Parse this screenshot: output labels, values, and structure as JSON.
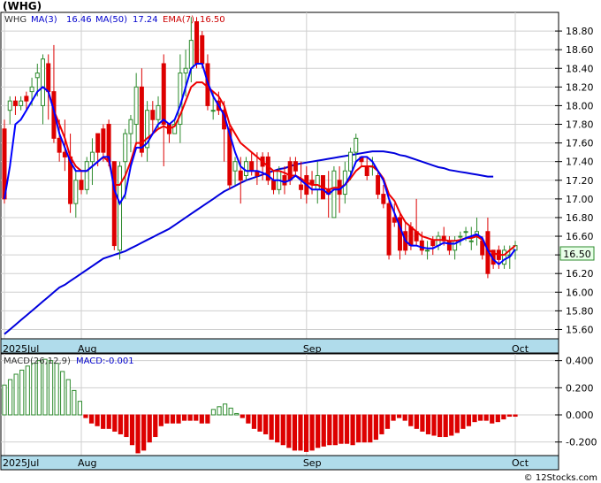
{
  "ticker_title": "(WHG)",
  "price_legend": {
    "symbol": "WHG",
    "ma3": "MA(3)",
    "ma3_value": "16.46",
    "ma50": "MA(50)",
    "ma50_value": "17.24",
    "ema7": "EMA(7)",
    "ema7_value": "16.50"
  },
  "macd_legend": {
    "label": "MACD(26,12,9)",
    "value": "MACD:-0.001"
  },
  "last_price_label": "16.50",
  "month_labels": [
    "2025Jul",
    "Aug",
    "Sep",
    "Oct"
  ],
  "copyright": "© 12Stocks.com",
  "colors": {
    "up": "#2e8b2e",
    "down": "#dd0000",
    "ma50": "#0000dd",
    "ma3": "#0000ff",
    "ema7": "#ee0000",
    "axis_band": "#b0dceb",
    "grid": "#cfcfcf",
    "price_tag": "#e8ffe8"
  },
  "chart_data": {
    "type": "candlestick",
    "price_axis": {
      "ylim": [
        15.5,
        19.0
      ],
      "ticks": [
        "15.60",
        "15.80",
        "16.00",
        "16.20",
        "16.40",
        "16.60",
        "16.80",
        "17.00",
        "17.20",
        "17.40",
        "17.60",
        "17.80",
        "18.00",
        "18.20",
        "18.40",
        "18.60",
        "18.80"
      ]
    },
    "macd_axis": {
      "ylim": [
        -0.3,
        0.45
      ],
      "ticks": [
        "-0.200",
        "0.000",
        "0.200",
        "0.400"
      ]
    },
    "candles": [
      [
        17.75,
        17.85,
        16.95,
        17.0
      ],
      [
        17.95,
        18.1,
        17.8,
        18.05
      ],
      [
        18.05,
        18.1,
        17.9,
        18.0
      ],
      [
        18.0,
        18.1,
        17.95,
        18.05
      ],
      [
        18.1,
        18.15,
        17.95,
        18.05
      ],
      [
        18.15,
        18.3,
        18.0,
        18.2
      ],
      [
        18.3,
        18.45,
        18.1,
        18.35
      ],
      [
        18.0,
        18.55,
        17.8,
        18.5
      ],
      [
        18.45,
        18.55,
        17.85,
        18.15
      ],
      [
        18.15,
        18.65,
        17.6,
        17.65
      ],
      [
        17.65,
        17.85,
        17.4,
        17.5
      ],
      [
        17.5,
        17.85,
        17.3,
        17.45
      ],
      [
        17.45,
        17.7,
        16.85,
        16.95
      ],
      [
        16.95,
        17.3,
        16.8,
        17.2
      ],
      [
        17.2,
        17.3,
        17.05,
        17.1
      ],
      [
        17.1,
        17.45,
        17.05,
        17.4
      ],
      [
        17.4,
        17.65,
        17.15,
        17.5
      ],
      [
        17.7,
        17.7,
        17.35,
        17.5
      ],
      [
        17.75,
        17.8,
        17.4,
        17.5
      ],
      [
        17.8,
        17.85,
        17.35,
        17.4
      ],
      [
        17.4,
        17.4,
        16.45,
        16.5
      ],
      [
        16.45,
        17.4,
        16.35,
        17.35
      ],
      [
        17.4,
        17.75,
        17.0,
        17.7
      ],
      [
        17.7,
        17.9,
        17.5,
        17.85
      ],
      [
        17.8,
        18.35,
        17.6,
        18.2
      ],
      [
        18.2,
        18.4,
        17.45,
        17.5
      ],
      [
        17.55,
        18.05,
        17.4,
        17.95
      ],
      [
        17.95,
        18.05,
        17.7,
        17.85
      ],
      [
        17.85,
        18.1,
        17.75,
        18.0
      ],
      [
        18.45,
        18.55,
        17.35,
        17.8
      ],
      [
        17.8,
        17.8,
        17.6,
        17.7
      ],
      [
        17.7,
        17.85,
        17.7,
        17.8
      ],
      [
        17.8,
        18.55,
        17.6,
        18.35
      ],
      [
        18.35,
        18.6,
        18.1,
        18.4
      ],
      [
        18.4,
        18.95,
        18.25,
        18.7
      ],
      [
        18.9,
        18.95,
        18.4,
        18.45
      ],
      [
        18.75,
        18.8,
        18.4,
        18.45
      ],
      [
        18.45,
        18.55,
        17.95,
        18.0
      ],
      [
        17.95,
        18.15,
        17.85,
        17.95
      ],
      [
        18.05,
        18.15,
        17.9,
        17.95
      ],
      [
        17.95,
        18.05,
        17.4,
        17.75
      ],
      [
        17.75,
        17.8,
        17.1,
        17.15
      ],
      [
        17.3,
        17.45,
        17.15,
        17.4
      ],
      [
        17.3,
        17.45,
        16.95,
        17.2
      ],
      [
        17.25,
        17.45,
        17.2,
        17.4
      ],
      [
        17.4,
        17.5,
        17.25,
        17.3
      ],
      [
        17.3,
        17.5,
        17.15,
        17.25
      ],
      [
        17.45,
        17.5,
        17.2,
        17.35
      ],
      [
        17.45,
        17.5,
        17.15,
        17.2
      ],
      [
        17.2,
        17.3,
        17.05,
        17.1
      ],
      [
        17.1,
        17.35,
        17.05,
        17.3
      ],
      [
        17.25,
        17.35,
        17.05,
        17.15
      ],
      [
        17.4,
        17.45,
        17.15,
        17.2
      ],
      [
        17.4,
        17.45,
        17.25,
        17.3
      ],
      [
        17.15,
        17.4,
        17.0,
        17.1
      ],
      [
        17.25,
        17.35,
        16.95,
        17.05
      ],
      [
        17.2,
        17.3,
        17.05,
        17.15
      ],
      [
        17.1,
        17.4,
        16.95,
        17.25
      ],
      [
        17.25,
        17.25,
        17.0,
        17.0
      ],
      [
        17.1,
        17.3,
        16.8,
        17.05
      ],
      [
        16.8,
        17.35,
        16.8,
        17.3
      ],
      [
        17.2,
        17.35,
        16.85,
        17.05
      ],
      [
        17.05,
        17.4,
        16.95,
        17.3
      ],
      [
        17.3,
        17.55,
        17.2,
        17.5
      ],
      [
        17.5,
        17.7,
        17.4,
        17.65
      ],
      [
        17.45,
        17.45,
        17.35,
        17.4
      ],
      [
        17.35,
        17.45,
        17.2,
        17.25
      ],
      [
        17.35,
        17.45,
        17.25,
        17.35
      ],
      [
        17.25,
        17.3,
        17.0,
        17.05
      ],
      [
        17.05,
        17.15,
        16.9,
        16.95
      ],
      [
        16.95,
        17.0,
        16.35,
        16.4
      ],
      [
        16.8,
        16.95,
        16.7,
        16.75
      ],
      [
        16.8,
        16.85,
        16.35,
        16.45
      ],
      [
        16.65,
        16.75,
        16.4,
        16.45
      ],
      [
        16.7,
        16.75,
        16.45,
        16.5
      ],
      [
        16.65,
        17.0,
        16.5,
        16.55
      ],
      [
        16.55,
        16.65,
        16.4,
        16.45
      ],
      [
        16.45,
        16.55,
        16.35,
        16.45
      ],
      [
        16.55,
        16.6,
        16.4,
        16.5
      ],
      [
        16.5,
        16.65,
        16.45,
        16.6
      ],
      [
        16.6,
        16.7,
        16.5,
        16.55
      ],
      [
        16.55,
        16.6,
        16.4,
        16.45
      ],
      [
        16.45,
        16.6,
        16.35,
        16.55
      ],
      [
        16.6,
        16.65,
        16.5,
        16.6
      ],
      [
        16.65,
        16.7,
        16.55,
        16.65
      ],
      [
        16.55,
        16.7,
        16.45,
        16.55
      ],
      [
        16.6,
        16.8,
        16.5,
        16.65
      ],
      [
        16.55,
        16.6,
        16.35,
        16.4
      ],
      [
        16.65,
        16.8,
        16.15,
        16.2
      ],
      [
        16.45,
        16.45,
        16.25,
        16.3
      ],
      [
        16.45,
        16.5,
        16.25,
        16.35
      ],
      [
        16.3,
        16.5,
        16.25,
        16.45
      ],
      [
        16.4,
        16.5,
        16.25,
        16.4
      ],
      [
        16.45,
        16.55,
        16.35,
        16.5
      ]
    ],
    "ma3": [
      17.0,
      17.35,
      17.8,
      17.85,
      17.95,
      18.05,
      18.15,
      18.2,
      18.15,
      17.95,
      17.7,
      17.55,
      17.4,
      17.3,
      17.3,
      17.3,
      17.35,
      17.4,
      17.45,
      17.45,
      17.1,
      16.95,
      17.05,
      17.35,
      17.55,
      17.55,
      17.6,
      17.7,
      17.8,
      17.85,
      17.8,
      17.85,
      18.0,
      18.2,
      18.4,
      18.45,
      18.45,
      18.25,
      18.1,
      18.0,
      17.9,
      17.7,
      17.5,
      17.35,
      17.3,
      17.3,
      17.3,
      17.28,
      17.25,
      17.2,
      17.2,
      17.18,
      17.2,
      17.25,
      17.2,
      17.15,
      17.1,
      17.1,
      17.1,
      17.05,
      17.1,
      17.1,
      17.15,
      17.25,
      17.4,
      17.45,
      17.45,
      17.4,
      17.3,
      17.2,
      17.0,
      16.85,
      16.7,
      16.55,
      16.5,
      16.5,
      16.48,
      16.47,
      16.47,
      16.5,
      16.53,
      16.52,
      16.52,
      16.55,
      16.58,
      16.6,
      16.62,
      16.58,
      16.45,
      16.35,
      16.3,
      16.35,
      16.38,
      16.46
    ],
    "ema7": [
      null,
      null,
      null,
      null,
      null,
      null,
      null,
      18.2,
      18.15,
      17.95,
      17.8,
      17.65,
      17.45,
      17.35,
      17.3,
      17.3,
      17.35,
      17.4,
      17.45,
      17.4,
      17.15,
      17.15,
      17.25,
      17.4,
      17.6,
      17.6,
      17.65,
      17.7,
      17.75,
      17.78,
      17.75,
      17.78,
      17.9,
      18.05,
      18.2,
      18.25,
      18.25,
      18.2,
      18.15,
      18.1,
      18.0,
      17.8,
      17.7,
      17.6,
      17.55,
      17.5,
      17.45,
      17.4,
      17.35,
      17.3,
      17.3,
      17.28,
      17.25,
      17.25,
      17.22,
      17.18,
      17.15,
      17.15,
      17.12,
      17.1,
      17.12,
      17.12,
      17.15,
      17.22,
      17.3,
      17.35,
      17.35,
      17.35,
      17.3,
      17.22,
      17.05,
      16.98,
      16.85,
      16.75,
      16.7,
      16.65,
      16.6,
      16.58,
      16.56,
      16.56,
      16.56,
      16.55,
      16.55,
      16.56,
      16.58,
      16.58,
      16.6,
      16.56,
      16.46,
      16.42,
      16.4,
      16.4,
      16.45,
      16.5
    ],
    "ma50": [
      15.55,
      15.6,
      15.65,
      15.7,
      15.75,
      15.8,
      15.85,
      15.9,
      15.95,
      16.0,
      16.05,
      16.08,
      16.12,
      16.16,
      16.2,
      16.24,
      16.28,
      16.32,
      16.36,
      16.38,
      16.4,
      16.42,
      16.44,
      16.47,
      16.5,
      16.53,
      16.56,
      16.59,
      16.62,
      16.65,
      16.68,
      16.72,
      16.76,
      16.8,
      16.84,
      16.88,
      16.92,
      16.96,
      17.0,
      17.04,
      17.08,
      17.11,
      17.14,
      17.17,
      17.2,
      17.22,
      17.24,
      17.26,
      17.28,
      17.3,
      17.32,
      17.33,
      17.35,
      17.37,
      17.38,
      17.39,
      17.4,
      17.41,
      17.42,
      17.43,
      17.44,
      17.45,
      17.46,
      17.47,
      17.48,
      17.49,
      17.5,
      17.51,
      17.51,
      17.51,
      17.5,
      17.49,
      17.47,
      17.46,
      17.44,
      17.42,
      17.4,
      17.38,
      17.36,
      17.34,
      17.33,
      17.31,
      17.3,
      17.29,
      17.28,
      17.27,
      17.26,
      17.25,
      17.24,
      17.24
    ],
    "macd_hist": [
      0.22,
      0.26,
      0.3,
      0.33,
      0.36,
      0.38,
      0.4,
      0.41,
      0.4,
      0.38,
      0.32,
      0.26,
      0.18,
      0.1,
      -0.02,
      -0.06,
      -0.08,
      -0.1,
      -0.1,
      -0.12,
      -0.14,
      -0.16,
      -0.22,
      -0.28,
      -0.26,
      -0.2,
      -0.16,
      -0.08,
      -0.06,
      -0.06,
      -0.06,
      -0.04,
      -0.04,
      -0.04,
      -0.06,
      -0.06,
      0.04,
      0.06,
      0.08,
      0.05,
      0.01,
      -0.02,
      -0.06,
      -0.1,
      -0.12,
      -0.14,
      -0.18,
      -0.2,
      -0.22,
      -0.24,
      -0.26,
      -0.26,
      -0.27,
      -0.26,
      -0.24,
      -0.23,
      -0.22,
      -0.22,
      -0.21,
      -0.21,
      -0.22,
      -0.2,
      -0.2,
      -0.2,
      -0.18,
      -0.14,
      -0.1,
      -0.04,
      -0.02,
      -0.04,
      -0.08,
      -0.1,
      -0.12,
      -0.14,
      -0.15,
      -0.16,
      -0.16,
      -0.15,
      -0.13,
      -0.1,
      -0.08,
      -0.05,
      -0.04,
      -0.04,
      -0.06,
      -0.05,
      -0.03,
      -0.01,
      -0.01
    ]
  }
}
